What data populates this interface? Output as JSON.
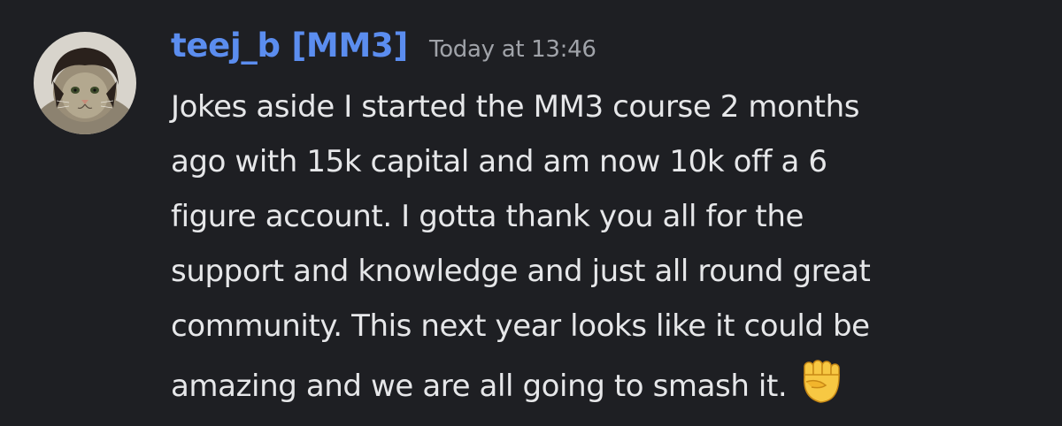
{
  "message": {
    "author": "teej_b [MM3]",
    "timestamp": "Today at 13:46",
    "lines": [
      "Jokes aside I started the MM3 course 2 months",
      "ago with 15k capital and am now 10k off a 6",
      "figure account. I gotta thank you all for the",
      "support and knowledge and just all round great",
      "community. This next year looks like it could be",
      "amazing and we are all going to smash it."
    ],
    "emoji": "raised-fist-emoji"
  },
  "colors": {
    "background": "#1e1f23",
    "username": "#5b8def",
    "timestamp": "#a0a3a9",
    "text": "#e6e7e9"
  }
}
